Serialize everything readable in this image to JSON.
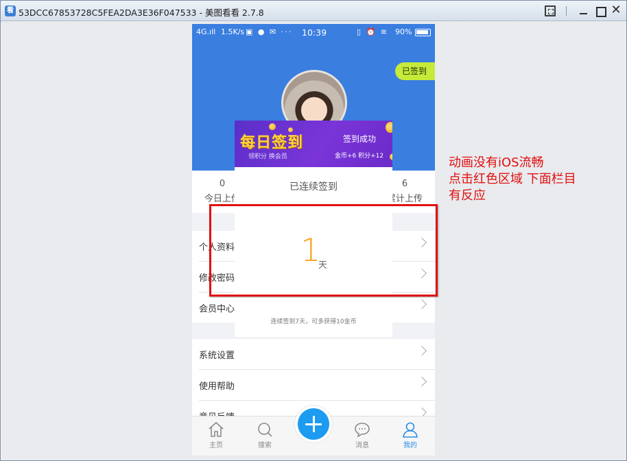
{
  "window": {
    "icon_glyph": "看",
    "title": "53DCC67853728C5FEA2DA3E36F047533 - 美图看看 2.7.8"
  },
  "status_bar": {
    "signal": "4G.ıll",
    "speed": "1.5K/s",
    "icons": "▣ ● ✉ ···",
    "time": "10:39",
    "right_icons": "▯ ⏰ ≋",
    "battery": "90%"
  },
  "header": {
    "checkin_pill": "已签到"
  },
  "stats": {
    "left_value": "0",
    "left_label": "今日上传",
    "right_value": "6",
    "right_label": "累计上传"
  },
  "menu_group_1": [
    {
      "label": "个人资料"
    },
    {
      "label": "修改密码"
    },
    {
      "label": "会员中心"
    }
  ],
  "menu_group_2": [
    {
      "label": "系统设置"
    },
    {
      "label": "使用帮助"
    },
    {
      "label": "意见反馈"
    }
  ],
  "tab_bar": {
    "home": "主页",
    "search": "搜索",
    "messages": "消息",
    "mine": "我的"
  },
  "popup": {
    "banner_title": "每日签到",
    "banner_sub": "领积分 换会员",
    "success": "签到成功",
    "reward": "金币+6 积分+12",
    "consecutive_label": "已连续签到",
    "days": "1",
    "day_unit": "天",
    "note": "连续签到7天，可多获得10金币"
  },
  "annotation": {
    "line1": "动画没有iOS流畅",
    "line2": "点击红色区域 下面栏目",
    "line3": "有反应",
    "color": "#e10f0f"
  },
  "colors": {
    "brand_blue": "#3a7ee0",
    "accent_green": "#c5ea3a",
    "coin_orange": "#f7a21b",
    "tab_active": "#2a8be6"
  }
}
